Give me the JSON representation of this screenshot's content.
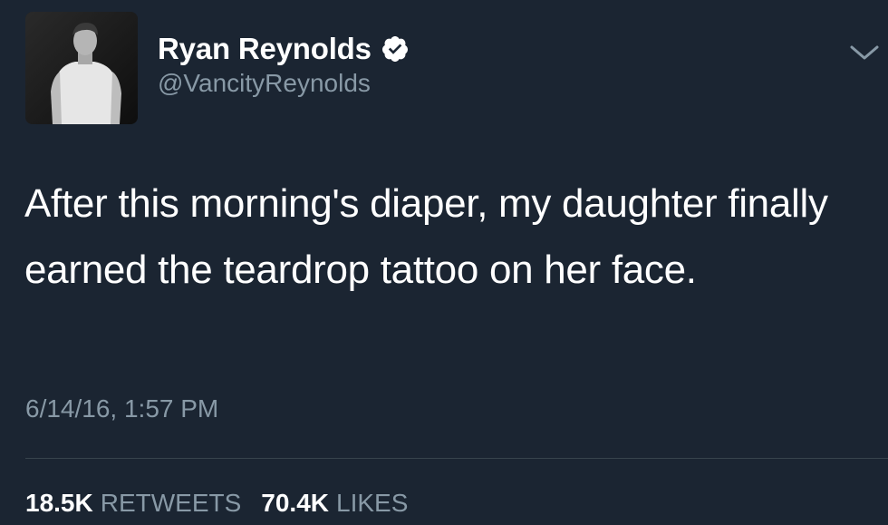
{
  "author": {
    "display_name": "Ryan Reynolds",
    "handle": "@VancityReynolds",
    "verified": true,
    "avatar_icon": "profile-photo"
  },
  "tweet": {
    "text": "After this morning's diaper, my daughter finally earned the teardrop tattoo on her face.",
    "timestamp": "6/14/16, 1:57 PM"
  },
  "stats": {
    "retweets_count": "18.5K",
    "retweets_label": "RETWEETS",
    "likes_count": "70.4K",
    "likes_label": "LIKES"
  },
  "colors": {
    "background": "#1b2532",
    "primary_text": "#ffffff",
    "secondary_text": "#8899a6",
    "divider": "#38444d"
  },
  "icons": {
    "verified": "verified-badge-icon",
    "menu": "chevron-down-icon"
  }
}
